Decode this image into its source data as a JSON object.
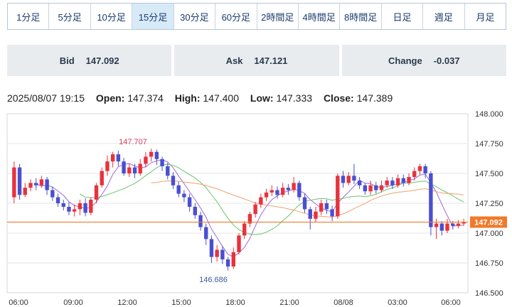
{
  "timeframes": [
    {
      "label": "1分足",
      "active": false
    },
    {
      "label": "5分足",
      "active": false
    },
    {
      "label": "10分足",
      "active": false
    },
    {
      "label": "15分足",
      "active": true
    },
    {
      "label": "30分足",
      "active": false
    },
    {
      "label": "60分足",
      "active": false
    },
    {
      "label": "2時間足",
      "active": false
    },
    {
      "label": "4時間足",
      "active": false
    },
    {
      "label": "8時間足",
      "active": false
    },
    {
      "label": "日足",
      "active": false
    },
    {
      "label": "週足",
      "active": false
    },
    {
      "label": "月足",
      "active": false
    }
  ],
  "quote": {
    "bid_label": "Bid",
    "bid": "147.092",
    "ask_label": "Ask",
    "ask": "147.121",
    "change_label": "Change",
    "change": "-0.037"
  },
  "ohlc": {
    "datetime": "2025/08/07 19:15",
    "open_label": "Open:",
    "open": "147.374",
    "high_label": "High:",
    "high": "147.400",
    "low_label": "Low:",
    "low": "147.333",
    "close_label": "Close:",
    "close": "147.389"
  },
  "chart_data": {
    "type": "candlestick",
    "y_ticks": [
      "148.000",
      "147.750",
      "147.500",
      "147.250",
      "147.000",
      "146.750",
      "146.500"
    ],
    "ylim": [
      146.5,
      148.0
    ],
    "x_ticks": [
      "06:00",
      "09:00",
      "12:00",
      "15:00",
      "18:00",
      "21:00",
      "08/08",
      "03:00",
      "06:00"
    ],
    "current_price": "147.092",
    "annotations": {
      "high": "147.707",
      "low": "146.686"
    },
    "candles": [
      [
        147.3,
        147.55,
        147.6,
        147.25
      ],
      [
        147.55,
        147.32,
        147.58,
        147.28
      ],
      [
        147.32,
        147.38,
        147.42,
        147.3
      ],
      [
        147.38,
        147.42,
        147.45,
        147.35
      ],
      [
        147.42,
        147.4,
        147.46,
        147.36
      ],
      [
        147.4,
        147.45,
        147.48,
        147.38
      ],
      [
        147.45,
        147.36,
        147.47,
        147.32
      ],
      [
        147.36,
        147.3,
        147.39,
        147.27
      ],
      [
        147.3,
        147.25,
        147.33,
        147.22
      ],
      [
        147.25,
        147.22,
        147.28,
        147.19
      ],
      [
        147.22,
        147.18,
        147.26,
        147.15
      ],
      [
        147.18,
        147.2,
        147.24,
        147.14
      ],
      [
        147.2,
        147.25,
        147.28,
        147.15
      ],
      [
        147.25,
        147.17,
        147.29,
        147.14
      ],
      [
        147.17,
        147.28,
        147.3,
        147.15
      ],
      [
        147.28,
        147.4,
        147.42,
        147.25
      ],
      [
        147.4,
        147.52,
        147.55,
        147.38
      ],
      [
        147.52,
        147.6,
        147.65,
        147.48
      ],
      [
        147.6,
        147.66,
        147.68,
        147.55
      ],
      [
        147.66,
        147.6,
        147.69,
        147.56
      ],
      [
        147.6,
        147.5,
        147.63,
        147.48
      ],
      [
        147.5,
        147.55,
        147.58,
        147.47
      ],
      [
        147.55,
        147.5,
        147.58,
        147.46
      ],
      [
        147.5,
        147.58,
        147.62,
        147.48
      ],
      [
        147.58,
        147.64,
        147.68,
        147.55
      ],
      [
        147.64,
        147.68,
        147.707,
        147.6
      ],
      [
        147.68,
        147.62,
        147.7,
        147.57
      ],
      [
        147.62,
        147.56,
        147.64,
        147.52
      ],
      [
        147.56,
        147.48,
        147.59,
        147.45
      ],
      [
        147.48,
        147.4,
        147.51,
        147.37
      ],
      [
        147.4,
        147.33,
        147.43,
        147.3
      ],
      [
        147.33,
        147.3,
        147.36,
        147.26
      ],
      [
        147.3,
        147.22,
        147.33,
        147.18
      ],
      [
        147.22,
        147.15,
        147.25,
        147.12
      ],
      [
        147.15,
        147.05,
        147.18,
        147.02
      ],
      [
        147.05,
        146.95,
        147.08,
        146.9
      ],
      [
        146.95,
        146.8,
        146.98,
        146.75
      ],
      [
        146.8,
        146.86,
        146.9,
        146.76
      ],
      [
        146.86,
        146.78,
        146.89,
        146.74
      ],
      [
        146.78,
        146.72,
        146.8,
        146.686
      ],
      [
        146.72,
        146.84,
        146.88,
        146.7
      ],
      [
        146.84,
        146.98,
        147.0,
        146.82
      ],
      [
        146.98,
        147.08,
        147.1,
        146.95
      ],
      [
        147.08,
        147.16,
        147.18,
        147.05
      ],
      [
        147.16,
        147.24,
        147.26,
        147.13
      ],
      [
        147.24,
        147.3,
        147.33,
        147.21
      ],
      [
        147.3,
        147.34,
        147.37,
        147.27
      ],
      [
        147.34,
        147.36,
        147.4,
        147.31
      ],
      [
        147.36,
        147.32,
        147.39,
        147.29
      ],
      [
        147.32,
        147.38,
        147.42,
        147.3
      ],
      [
        147.38,
        147.36,
        147.41,
        147.32
      ],
      [
        147.36,
        147.42,
        147.47,
        147.34
      ],
      [
        147.42,
        147.3,
        147.44,
        147.27
      ],
      [
        147.3,
        147.2,
        147.33,
        147.17
      ],
      [
        147.2,
        147.12,
        147.22,
        147.03
      ],
      [
        147.12,
        147.18,
        147.22,
        147.09
      ],
      [
        147.18,
        147.25,
        147.28,
        147.15
      ],
      [
        147.25,
        147.2,
        147.28,
        147.16
      ],
      [
        147.2,
        147.14,
        147.23,
        147.1
      ],
      [
        147.14,
        147.48,
        147.5,
        147.12
      ],
      [
        147.48,
        147.42,
        147.52,
        147.38
      ],
      [
        147.42,
        147.48,
        147.51,
        147.4
      ],
      [
        147.48,
        147.44,
        147.58,
        147.41
      ],
      [
        147.44,
        147.4,
        147.47,
        147.37
      ],
      [
        147.4,
        147.35,
        147.42,
        147.32
      ],
      [
        147.35,
        147.4,
        147.44,
        147.32
      ],
      [
        147.4,
        147.36,
        147.43,
        147.33
      ],
      [
        147.36,
        147.4,
        147.44,
        147.34
      ],
      [
        147.4,
        147.44,
        147.47,
        147.38
      ],
      [
        147.44,
        147.4,
        147.47,
        147.37
      ],
      [
        147.4,
        147.46,
        147.49,
        147.38
      ],
      [
        147.46,
        147.42,
        147.49,
        147.39
      ],
      [
        147.42,
        147.47,
        147.5,
        147.4
      ],
      [
        147.47,
        147.52,
        147.55,
        147.44
      ],
      [
        147.52,
        147.56,
        147.58,
        147.49
      ],
      [
        147.56,
        147.5,
        147.58,
        147.46
      ],
      [
        147.5,
        147.05,
        147.52,
        146.98
      ],
      [
        147.05,
        147.08,
        147.12,
        146.95
      ],
      [
        147.08,
        147.02,
        147.1,
        146.98
      ],
      [
        147.02,
        147.08,
        147.12,
        147.0
      ],
      [
        147.08,
        147.06,
        147.1,
        147.03
      ],
      [
        147.06,
        147.08,
        147.11,
        147.04
      ],
      [
        147.08,
        147.092,
        147.12,
        147.06
      ]
    ]
  }
}
